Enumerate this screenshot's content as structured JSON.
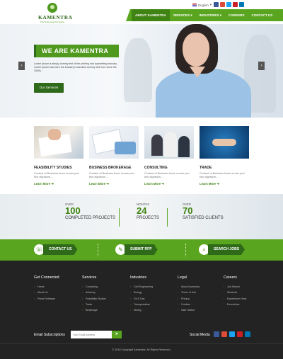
{
  "brand": {
    "name": "KAMENTRA",
    "tagline": "The Technocrat Company"
  },
  "topbar": {
    "language": "English",
    "social": [
      {
        "icon": "facebook-icon",
        "color": "#3b5998"
      },
      {
        "icon": "google-plus-icon",
        "color": "#dd4b39"
      },
      {
        "icon": "twitter-icon",
        "color": "#1da1f2"
      },
      {
        "icon": "pinterest-icon",
        "color": "#cb2027"
      },
      {
        "icon": "linkedin-icon",
        "color": "#0077b5"
      }
    ]
  },
  "nav": [
    {
      "label": "ABOUT KAMENTRA",
      "active": true
    },
    {
      "label": "SERVICES ▾",
      "active": false
    },
    {
      "label": "INDUSTRIES ▾",
      "active": false
    },
    {
      "label": "CAREERS",
      "active": false
    },
    {
      "label": "CONTACT US",
      "active": false
    }
  ],
  "hero": {
    "title": "WE ARE KAMENTRA",
    "text": "Lorem Ipsum is simply dummy text of the printing and typesetting industry. Lorem Ipsum has been the industry's standard dummy text ever since the 1500s.",
    "button": "Our Services",
    "prev": "‹",
    "next": "›"
  },
  "services": [
    {
      "title": "FEASIBILITY STUDIES",
      "desc": "Content of Business fusce ornare port titor dignissim....",
      "more": "Learn More ➔"
    },
    {
      "title": "BUSINESS BROKERAGE",
      "desc": "Content of Business fusce ornare port titor dignissim....",
      "more": "Learn More ➔"
    },
    {
      "title": "CONSULTING",
      "desc": "Content of Business fusce ornare port titor dignissim....",
      "more": "Learn More ➔"
    },
    {
      "title": "TRADE",
      "desc": "Content of Business fusce ornare port titor dignissim....",
      "more": "Learn More ➔"
    }
  ],
  "stats": [
    {
      "over": "OVER",
      "num": "100",
      "label": "COMPLETED PROJECTS"
    },
    {
      "over": "MONTHS",
      "num": "24",
      "label": "PROJECTS"
    },
    {
      "over": "OVER",
      "num": "70",
      "label": "SATISFIED CLIENTS"
    }
  ],
  "cta": [
    {
      "icon": "contact-icon",
      "glyph": "☏",
      "label": "CONTACT US"
    },
    {
      "icon": "document-icon",
      "glyph": "✎",
      "label": "SUBMIT RFP"
    },
    {
      "icon": "search-icon",
      "glyph": "⌕",
      "label": "SEARCH JOBS"
    }
  ],
  "footer": {
    "columns": [
      {
        "title": "Get Connected",
        "items": [
          "Home",
          "About Us",
          "Press Releases"
        ]
      },
      {
        "title": "Services",
        "items": [
          "Consulting",
          "Advisory",
          "Feasibility Studies",
          "Trade",
          "Brokerage"
        ]
      },
      {
        "title": "Industries",
        "items": [
          "Civil Engineering",
          "Energy",
          "Oil & Gas",
          "Transportation",
          "Mining"
        ]
      },
      {
        "title": "Legal",
        "items": [
          "About Kamentra",
          "Terms of Use",
          "Privacy",
          "Cookies",
          "Safe Harbor"
        ]
      },
      {
        "title": "Careers",
        "items": [
          "Job Search",
          "Students",
          "Experience Hires",
          "Executives"
        ]
      }
    ],
    "email_label": "Email Subscriptions",
    "email_placeholder": "Your Email Address",
    "email_submit": "➤",
    "social_label": "Social Media",
    "copyright": "© 2016 Copyright Kamentra. All Rights Reserved."
  },
  "colors": {
    "primary": "#5aa51f",
    "dark": "#2f6a1b",
    "footer": "#232323"
  }
}
